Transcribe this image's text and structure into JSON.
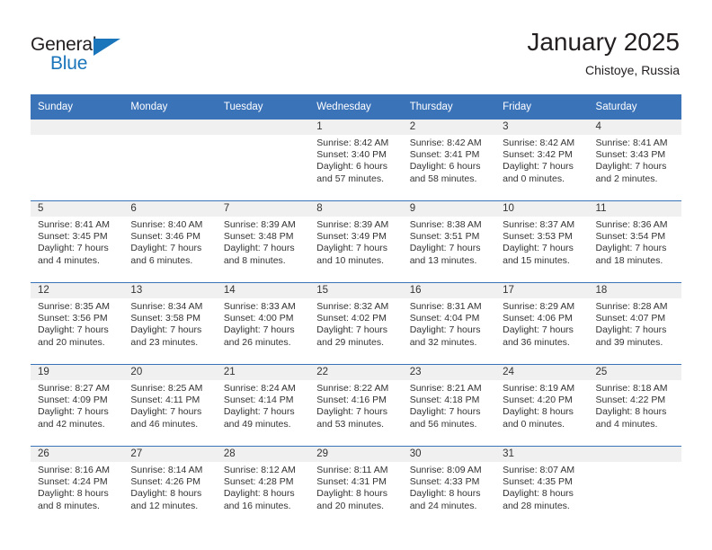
{
  "brand": {
    "name_part1": "General",
    "name_part2": "Blue",
    "accent_color": "#1b75bb"
  },
  "header": {
    "title": "January 2025",
    "location": "Chistoye, Russia"
  },
  "theme": {
    "header_blue": "#3b73b9",
    "daynum_band": "#f0f0f0",
    "text": "#333333"
  },
  "weekdays": [
    "Sunday",
    "Monday",
    "Tuesday",
    "Wednesday",
    "Thursday",
    "Friday",
    "Saturday"
  ],
  "weeks": [
    [
      {
        "day": "",
        "sunrise": "",
        "sunset": "",
        "daylight1": "",
        "daylight2": ""
      },
      {
        "day": "",
        "sunrise": "",
        "sunset": "",
        "daylight1": "",
        "daylight2": ""
      },
      {
        "day": "",
        "sunrise": "",
        "sunset": "",
        "daylight1": "",
        "daylight2": ""
      },
      {
        "day": "1",
        "sunrise": "Sunrise: 8:42 AM",
        "sunset": "Sunset: 3:40 PM",
        "daylight1": "Daylight: 6 hours",
        "daylight2": "and 57 minutes."
      },
      {
        "day": "2",
        "sunrise": "Sunrise: 8:42 AM",
        "sunset": "Sunset: 3:41 PM",
        "daylight1": "Daylight: 6 hours",
        "daylight2": "and 58 minutes."
      },
      {
        "day": "3",
        "sunrise": "Sunrise: 8:42 AM",
        "sunset": "Sunset: 3:42 PM",
        "daylight1": "Daylight: 7 hours",
        "daylight2": "and 0 minutes."
      },
      {
        "day": "4",
        "sunrise": "Sunrise: 8:41 AM",
        "sunset": "Sunset: 3:43 PM",
        "daylight1": "Daylight: 7 hours",
        "daylight2": "and 2 minutes."
      }
    ],
    [
      {
        "day": "5",
        "sunrise": "Sunrise: 8:41 AM",
        "sunset": "Sunset: 3:45 PM",
        "daylight1": "Daylight: 7 hours",
        "daylight2": "and 4 minutes."
      },
      {
        "day": "6",
        "sunrise": "Sunrise: 8:40 AM",
        "sunset": "Sunset: 3:46 PM",
        "daylight1": "Daylight: 7 hours",
        "daylight2": "and 6 minutes."
      },
      {
        "day": "7",
        "sunrise": "Sunrise: 8:39 AM",
        "sunset": "Sunset: 3:48 PM",
        "daylight1": "Daylight: 7 hours",
        "daylight2": "and 8 minutes."
      },
      {
        "day": "8",
        "sunrise": "Sunrise: 8:39 AM",
        "sunset": "Sunset: 3:49 PM",
        "daylight1": "Daylight: 7 hours",
        "daylight2": "and 10 minutes."
      },
      {
        "day": "9",
        "sunrise": "Sunrise: 8:38 AM",
        "sunset": "Sunset: 3:51 PM",
        "daylight1": "Daylight: 7 hours",
        "daylight2": "and 13 minutes."
      },
      {
        "day": "10",
        "sunrise": "Sunrise: 8:37 AM",
        "sunset": "Sunset: 3:53 PM",
        "daylight1": "Daylight: 7 hours",
        "daylight2": "and 15 minutes."
      },
      {
        "day": "11",
        "sunrise": "Sunrise: 8:36 AM",
        "sunset": "Sunset: 3:54 PM",
        "daylight1": "Daylight: 7 hours",
        "daylight2": "and 18 minutes."
      }
    ],
    [
      {
        "day": "12",
        "sunrise": "Sunrise: 8:35 AM",
        "sunset": "Sunset: 3:56 PM",
        "daylight1": "Daylight: 7 hours",
        "daylight2": "and 20 minutes."
      },
      {
        "day": "13",
        "sunrise": "Sunrise: 8:34 AM",
        "sunset": "Sunset: 3:58 PM",
        "daylight1": "Daylight: 7 hours",
        "daylight2": "and 23 minutes."
      },
      {
        "day": "14",
        "sunrise": "Sunrise: 8:33 AM",
        "sunset": "Sunset: 4:00 PM",
        "daylight1": "Daylight: 7 hours",
        "daylight2": "and 26 minutes."
      },
      {
        "day": "15",
        "sunrise": "Sunrise: 8:32 AM",
        "sunset": "Sunset: 4:02 PM",
        "daylight1": "Daylight: 7 hours",
        "daylight2": "and 29 minutes."
      },
      {
        "day": "16",
        "sunrise": "Sunrise: 8:31 AM",
        "sunset": "Sunset: 4:04 PM",
        "daylight1": "Daylight: 7 hours",
        "daylight2": "and 32 minutes."
      },
      {
        "day": "17",
        "sunrise": "Sunrise: 8:29 AM",
        "sunset": "Sunset: 4:06 PM",
        "daylight1": "Daylight: 7 hours",
        "daylight2": "and 36 minutes."
      },
      {
        "day": "18",
        "sunrise": "Sunrise: 8:28 AM",
        "sunset": "Sunset: 4:07 PM",
        "daylight1": "Daylight: 7 hours",
        "daylight2": "and 39 minutes."
      }
    ],
    [
      {
        "day": "19",
        "sunrise": "Sunrise: 8:27 AM",
        "sunset": "Sunset: 4:09 PM",
        "daylight1": "Daylight: 7 hours",
        "daylight2": "and 42 minutes."
      },
      {
        "day": "20",
        "sunrise": "Sunrise: 8:25 AM",
        "sunset": "Sunset: 4:11 PM",
        "daylight1": "Daylight: 7 hours",
        "daylight2": "and 46 minutes."
      },
      {
        "day": "21",
        "sunrise": "Sunrise: 8:24 AM",
        "sunset": "Sunset: 4:14 PM",
        "daylight1": "Daylight: 7 hours",
        "daylight2": "and 49 minutes."
      },
      {
        "day": "22",
        "sunrise": "Sunrise: 8:22 AM",
        "sunset": "Sunset: 4:16 PM",
        "daylight1": "Daylight: 7 hours",
        "daylight2": "and 53 minutes."
      },
      {
        "day": "23",
        "sunrise": "Sunrise: 8:21 AM",
        "sunset": "Sunset: 4:18 PM",
        "daylight1": "Daylight: 7 hours",
        "daylight2": "and 56 minutes."
      },
      {
        "day": "24",
        "sunrise": "Sunrise: 8:19 AM",
        "sunset": "Sunset: 4:20 PM",
        "daylight1": "Daylight: 8 hours",
        "daylight2": "and 0 minutes."
      },
      {
        "day": "25",
        "sunrise": "Sunrise: 8:18 AM",
        "sunset": "Sunset: 4:22 PM",
        "daylight1": "Daylight: 8 hours",
        "daylight2": "and 4 minutes."
      }
    ],
    [
      {
        "day": "26",
        "sunrise": "Sunrise: 8:16 AM",
        "sunset": "Sunset: 4:24 PM",
        "daylight1": "Daylight: 8 hours",
        "daylight2": "and 8 minutes."
      },
      {
        "day": "27",
        "sunrise": "Sunrise: 8:14 AM",
        "sunset": "Sunset: 4:26 PM",
        "daylight1": "Daylight: 8 hours",
        "daylight2": "and 12 minutes."
      },
      {
        "day": "28",
        "sunrise": "Sunrise: 8:12 AM",
        "sunset": "Sunset: 4:28 PM",
        "daylight1": "Daylight: 8 hours",
        "daylight2": "and 16 minutes."
      },
      {
        "day": "29",
        "sunrise": "Sunrise: 8:11 AM",
        "sunset": "Sunset: 4:31 PM",
        "daylight1": "Daylight: 8 hours",
        "daylight2": "and 20 minutes."
      },
      {
        "day": "30",
        "sunrise": "Sunrise: 8:09 AM",
        "sunset": "Sunset: 4:33 PM",
        "daylight1": "Daylight: 8 hours",
        "daylight2": "and 24 minutes."
      },
      {
        "day": "31",
        "sunrise": "Sunrise: 8:07 AM",
        "sunset": "Sunset: 4:35 PM",
        "daylight1": "Daylight: 8 hours",
        "daylight2": "and 28 minutes."
      },
      {
        "day": "",
        "sunrise": "",
        "sunset": "",
        "daylight1": "",
        "daylight2": ""
      }
    ]
  ]
}
